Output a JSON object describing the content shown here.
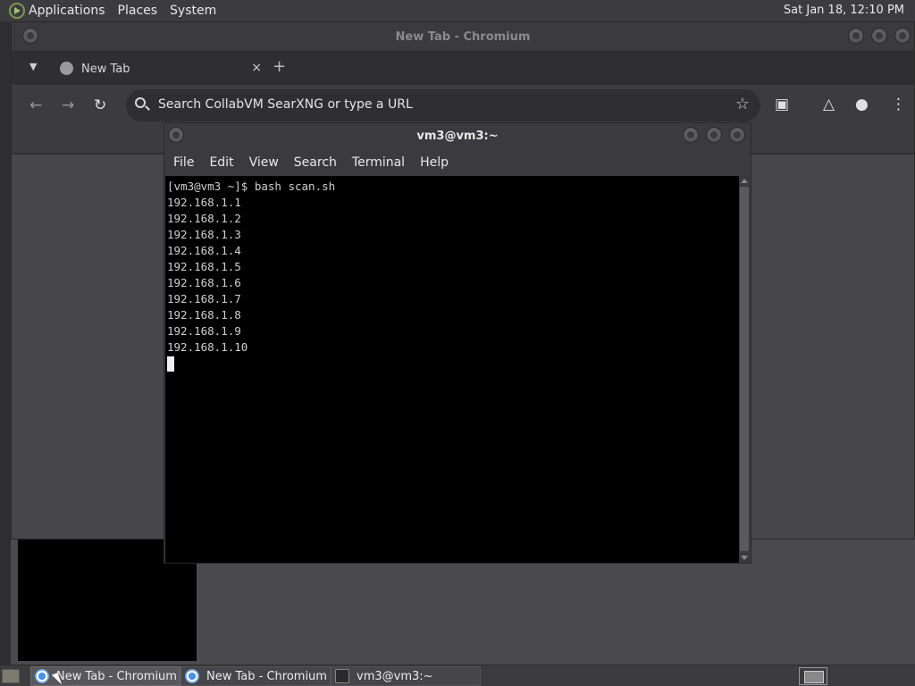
{
  "top_panel": {
    "menus": [
      "Applications",
      "Places",
      "System"
    ],
    "clock": "Sat Jan 18, 12:10 PM"
  },
  "chromium": {
    "window_title": "New Tab - Chromium",
    "tab_label": "New Tab",
    "tab_close": "×",
    "new_tab": "+",
    "omnibox_placeholder": "Search CollabVM SearXNG or type a URL",
    "icons": [
      "back-arrow-icon",
      "forward-arrow-icon",
      "reload-icon",
      "search-icon",
      "star-icon",
      "extensions-icon",
      "labs-flask-icon",
      "profile-icon",
      "kebab-menu-icon"
    ]
  },
  "terminal": {
    "window_title": "vm3@vm3:~",
    "menus": [
      "File",
      "Edit",
      "View",
      "Search",
      "Terminal",
      "Help"
    ],
    "lines": [
      "[vm3@vm3 ~]$ bash scan.sh",
      "192.168.1.1",
      "192.168.1.2",
      "192.168.1.3",
      "192.168.1.4",
      "192.168.1.5",
      "192.168.1.6",
      "192.168.1.7",
      "192.168.1.8",
      "192.168.1.9",
      "192.168.1.10"
    ]
  },
  "taskbar": {
    "tasks": [
      {
        "label": "New Tab - Chromium",
        "icon": "chromium-icon",
        "active": true
      },
      {
        "label": "New Tab - Chromium",
        "icon": "chromium-icon",
        "active": false
      },
      {
        "label": "vm3@vm3:~",
        "icon": "terminal-icon",
        "active": false
      }
    ]
  }
}
